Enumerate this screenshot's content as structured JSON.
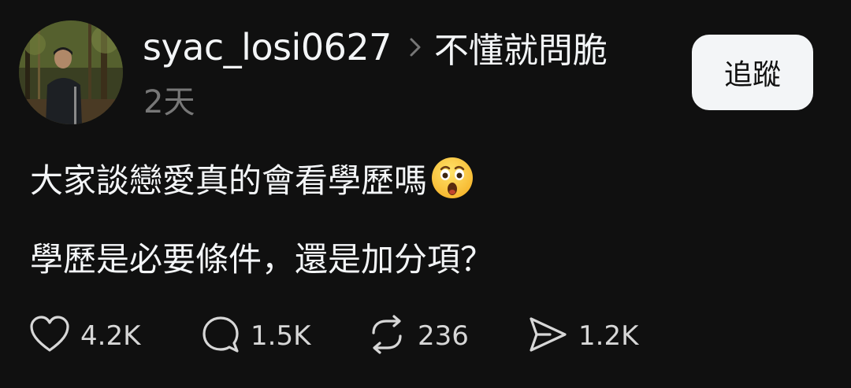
{
  "post": {
    "username": "syac_losi0627",
    "topic": "不懂就問脆",
    "time": "2天",
    "follow_label": "追蹤",
    "line1": "大家談戀愛真的會看學歷嗎",
    "line1_emoji": "astonished-face-emoji",
    "line2": "學歷是必要條件，還是加分項？"
  },
  "actions": {
    "likes": "4.2K",
    "replies": "1.5K",
    "reposts": "236",
    "shares": "1.2K"
  },
  "icons": {
    "like": "heart-icon",
    "reply": "speech-bubble-icon",
    "repost": "repost-icon",
    "share": "send-icon",
    "chevron": "chevron-right-icon"
  },
  "colors": {
    "background": "#101010",
    "text_primary": "#f3f5f7",
    "text_secondary": "#777777",
    "button_bg": "#f3f5f7",
    "button_text": "#101010"
  }
}
